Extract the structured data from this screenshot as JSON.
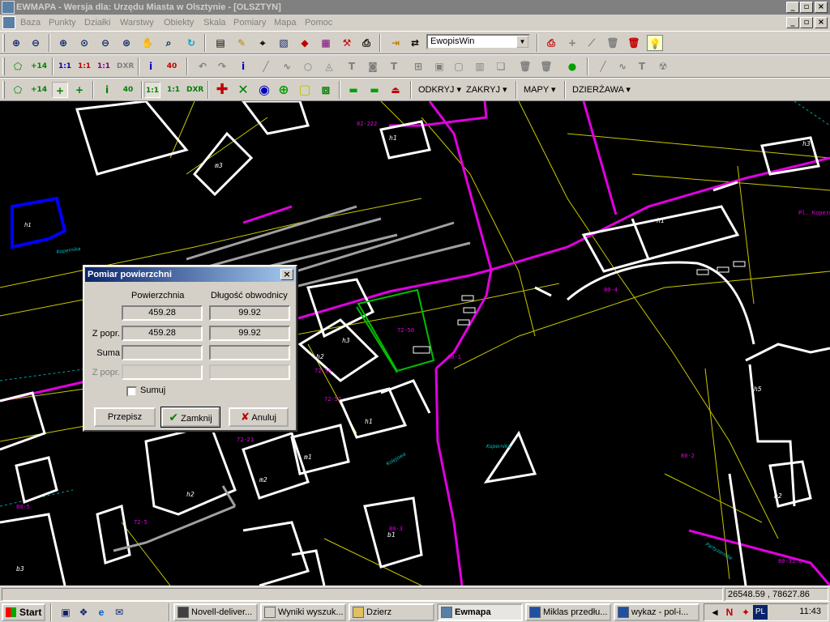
{
  "window": {
    "title": "EWMAPA - Wersja dla: Urzędu Miasta w Olsztynie - [OLSZTYN]"
  },
  "menu": [
    "Baza",
    "Punkty",
    "Działki",
    "Warstwy",
    "Obiekty",
    "Skala",
    "Pomiary",
    "Mapa",
    "Pomoc"
  ],
  "toolbar": {
    "combo_value": "EwopisWin",
    "text_buttons": {
      "odkryj": "ODKRYJ ▾",
      "zakryj": "ZAKRYJ ▾",
      "mapy": "MAPY ▾",
      "dzierzawa": "DZIERŻAWA ▾"
    },
    "row2_labels": [
      "+14",
      "1:1",
      "1:1",
      "1:1",
      "DXR",
      "i",
      "40"
    ],
    "row3_labels": [
      "+14",
      "+",
      "+",
      "i",
      "40",
      "1:1",
      "1:1",
      "DXR"
    ]
  },
  "map": {
    "labels": [
      "80-3",
      "82-222",
      "h1",
      "h3",
      "h2",
      "h3",
      "80-1",
      "72-50",
      "72-56",
      "72-57",
      "m1",
      "m2",
      "m3",
      "h1",
      "h2",
      "h5",
      "b1",
      "b2",
      "b3",
      "80-2",
      "72-21",
      "72-5",
      "80-31.8",
      "Kopernika",
      "Kolejowa",
      "Kopernika",
      "Partyzantów",
      "Pl. Kopernika",
      "80-4",
      "80-5",
      "72-161.2"
    ]
  },
  "dialog": {
    "title": "Pomiar powierzchni",
    "col_area": "Powierzchnia",
    "col_perimeter": "Długość obwodnicy",
    "rows": [
      {
        "label": "",
        "area": "459.28",
        "perimeter": "99.92"
      },
      {
        "label": "Z popr.",
        "area": "459.28",
        "perimeter": "99.92"
      },
      {
        "label": "Suma",
        "area": "",
        "perimeter": ""
      },
      {
        "label": "Z popr.",
        "area": "",
        "perimeter": ""
      }
    ],
    "checkbox_label": "Sumuj",
    "btn_przepisz": "Przepisz",
    "btn_zamknij": "Zamknij",
    "btn_anuluj": "Anuluj"
  },
  "status": {
    "coordinates": "26548.59 , 78627.86"
  },
  "taskbar": {
    "start": "Start",
    "tasks": [
      "Novell-deliver...",
      "Wyniki wyszuk...",
      "Dzierz",
      "Ewmapa",
      "Miklas  przedłu...",
      "wykaz - pol-i..."
    ],
    "lang": "PL",
    "clock": "11:43"
  }
}
